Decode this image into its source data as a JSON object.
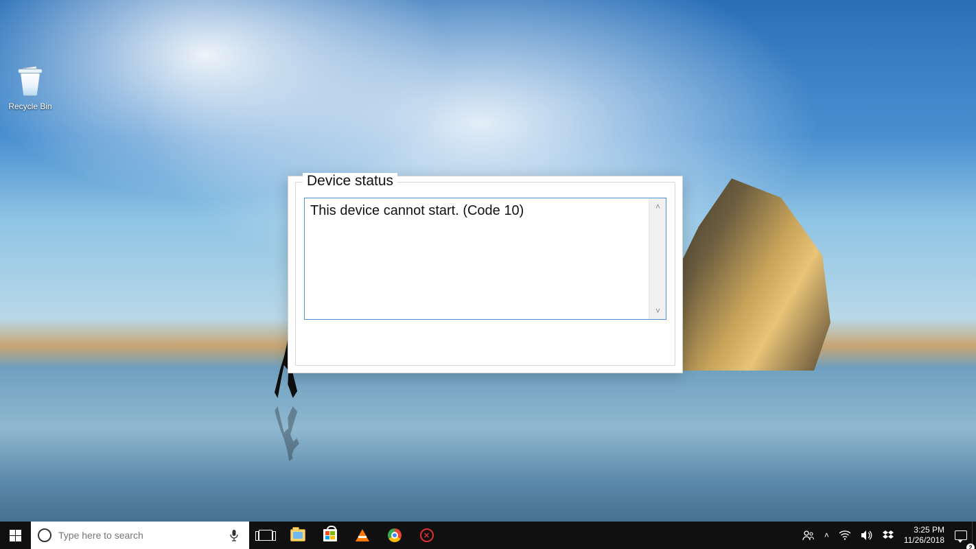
{
  "desktop": {
    "icons": {
      "recycle_bin_label": "Recycle Bin"
    }
  },
  "dialog": {
    "group_label": "Device status",
    "message": "This device cannot start. (Code 10)"
  },
  "taskbar": {
    "search_placeholder": "Type here to search",
    "pinned": {
      "task_view": "Task View",
      "file_explorer": "File Explorer",
      "microsoft_store": "Microsoft Store",
      "vlc": "VLC media player",
      "chrome": "Google Chrome",
      "app_red": "App"
    },
    "tray": {
      "people": "People",
      "hidden_icons": "Show hidden icons",
      "wifi": "Network",
      "volume": "Volume",
      "dropbox": "Dropbox",
      "action_center_count": "2"
    },
    "clock": {
      "time": "3:25 PM",
      "date": "11/26/2018"
    }
  }
}
